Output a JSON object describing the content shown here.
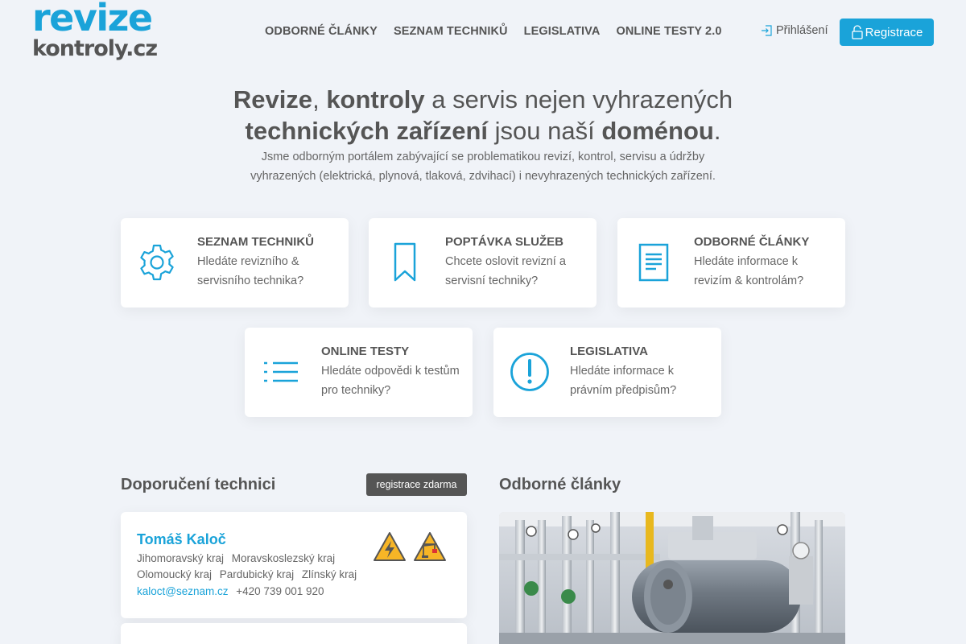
{
  "header": {
    "logo_line1": "revize",
    "logo_line2": "kontroly.cz",
    "nav": [
      "ODBORNÉ ČLÁNKY",
      "SEZNAM TECHNIKŮ",
      "LEGISLATIVA",
      "ONLINE TESTY 2.0"
    ],
    "login_label": "Přihlášení",
    "register_label": "Registrace"
  },
  "hero": {
    "t1_b1": "Revize",
    "t1_c1": ",",
    "t1_b2": "kontroly",
    "t1_r1": "a servis nejen vyhrazených",
    "t2_b1": "technických zařízení",
    "t2_r1": "jsou naší",
    "t2_b2": "doménou",
    "t2_r2": ".",
    "subtitle_l1": "Jsme odborným portálem zabývající se problematikou revizí, kontrol, servisu a údržby",
    "subtitle_l2": "vyhrazených (elektrická, plynová, tlaková, zdvihací) i nevyhrazených technických zařízení."
  },
  "cards": [
    {
      "title": "SEZNAM TECHNIKŮ",
      "desc": "Hledáte revizního & servisního technika?",
      "icon": "gear-icon"
    },
    {
      "title": "POPTÁVKA SLUŽEB",
      "desc": "Chcete oslovit revizní a servisní techniky?",
      "icon": "bookmark-icon"
    },
    {
      "title": "ODBORNÉ ČLÁNKY",
      "desc": "Hledáte informace k revizím & kontrolám?",
      "icon": "document-icon"
    },
    {
      "title": "ONLINE TESTY",
      "desc": "Hledáte odpovědi k testům pro techniky?",
      "icon": "list-icon"
    },
    {
      "title": "LEGISLATIVA",
      "desc": "Hledáte informace k právním předpisům?",
      "icon": "exclamation-icon"
    }
  ],
  "technicians": {
    "title": "Doporučení technici",
    "badge": "registrace zdarma",
    "items": [
      {
        "name": "Tomáš Kaloč",
        "regions": [
          "Jihomoravský kraj",
          "Moravskoslezský kraj",
          "Olomoucký kraj",
          "Pardubický kraj",
          "Zlínský kraj"
        ],
        "email": "kaloct@seznam.cz",
        "phone": "+420 739 001 920",
        "icons": [
          "electrical-warning-icon",
          "lifting-warning-icon"
        ]
      }
    ]
  },
  "articles": {
    "title": "Odborné články"
  },
  "colors": {
    "accent": "#1aa3d9",
    "text": "#555555",
    "background": "#f0f3f8",
    "warning": "#f7b526"
  }
}
